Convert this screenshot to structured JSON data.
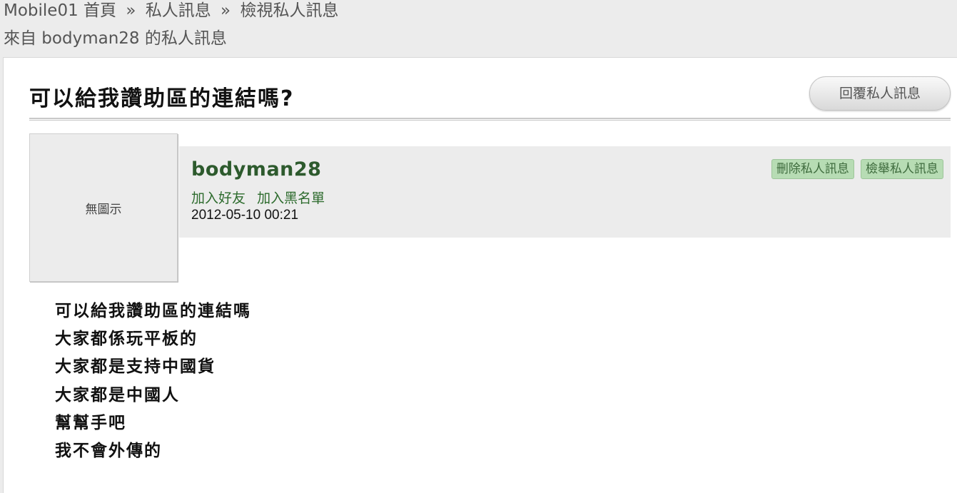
{
  "breadcrumb": {
    "home": "Mobile01 首頁",
    "sep": "»",
    "pm": "私人訊息",
    "view": "檢視私人訊息"
  },
  "subtitle": "來自 bodyman28 的私人訊息",
  "message": {
    "title": "可以給我讚助區的連結嗎?",
    "reply_label": "回覆私人訊息",
    "avatar_text": "無圖示",
    "username": "bodyman28",
    "add_friend": "加入好友",
    "add_blacklist": "加入黑名單",
    "date": "2012-05-10 00:21",
    "delete_label": "刪除私人訊息",
    "report_label": "檢舉私人訊息",
    "body_lines": [
      "可以給我讚助區的連結嗎",
      "大家都係玩平板的",
      "大家都是支持中國貨",
      "大家都是中國人",
      "幫幫手吧",
      "我不會外傳的"
    ]
  },
  "colors": {
    "username": "#2d5a2d",
    "action_button_bg": "#b7dcb4",
    "page_bg": "#ececec"
  }
}
